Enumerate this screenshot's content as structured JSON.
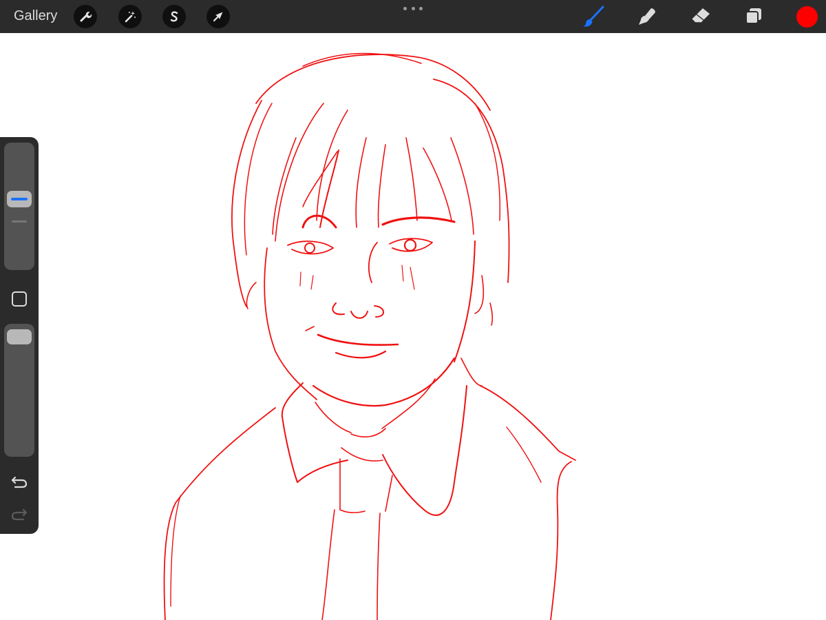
{
  "topbar": {
    "gallery_label": "Gallery",
    "actions": [
      {
        "name": "actions",
        "icon": "wrench-icon"
      },
      {
        "name": "adjustments",
        "icon": "magic-wand-icon"
      },
      {
        "name": "selection",
        "icon": "selection-s-icon"
      },
      {
        "name": "transform",
        "icon": "arrow-cursor-icon"
      }
    ],
    "more_icon": "more-dots-icon",
    "right_tools": [
      {
        "name": "brush",
        "icon": "brush-icon",
        "active": true
      },
      {
        "name": "smudge",
        "icon": "smudge-finger-icon",
        "active": false
      },
      {
        "name": "eraser",
        "icon": "eraser-icon",
        "active": false
      },
      {
        "name": "layers",
        "icon": "layers-icon",
        "active": false
      }
    ],
    "current_color": "#ff0000"
  },
  "sidebar": {
    "brush_size_icon": "brush-size-slider",
    "modify_icon": "square-modify-icon",
    "opacity_icon": "opacity-slider",
    "undo_icon": "undo-icon",
    "redo_icon": "redo-icon"
  },
  "colors": {
    "bar": "#2b2b2b",
    "active_tool": "#1a73ff",
    "stroke": "#ff0000",
    "canvas": "#ffffff"
  }
}
